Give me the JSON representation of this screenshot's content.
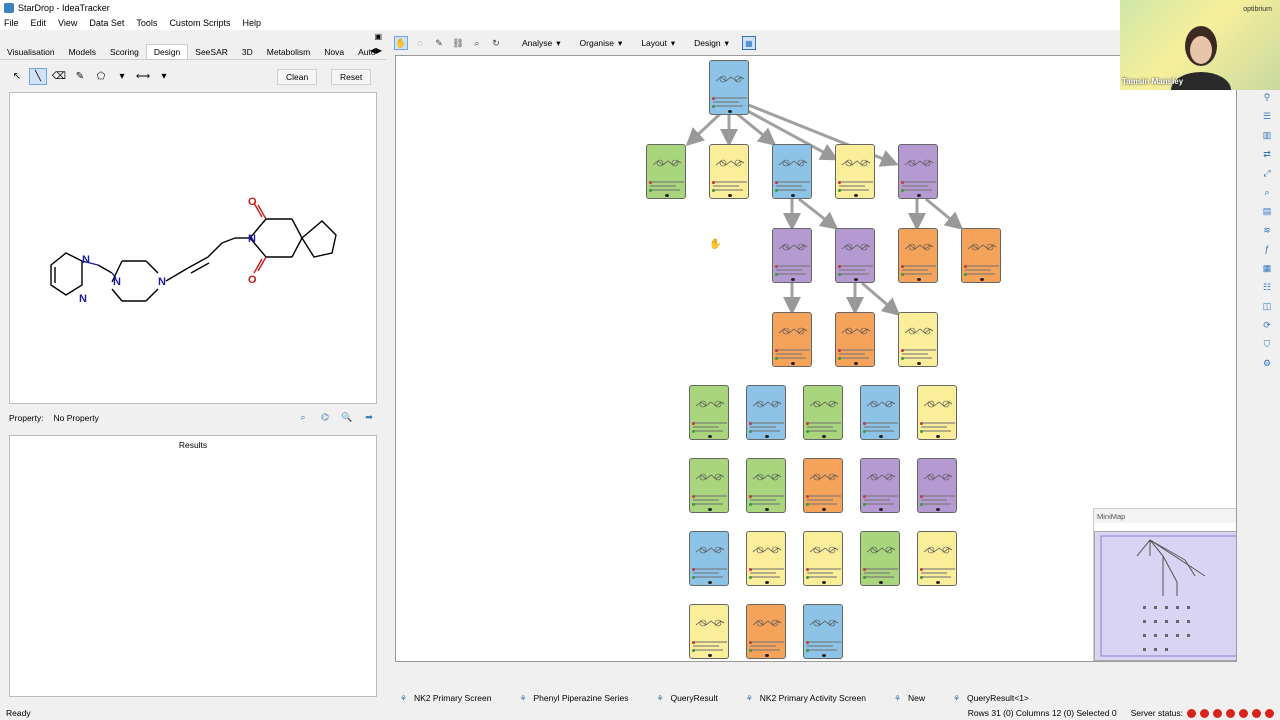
{
  "window": {
    "title": "StarDrop - IdeaTracker"
  },
  "menu": [
    "File",
    "Edit",
    "View",
    "Data Set",
    "Tools",
    "Custom Scripts",
    "Help"
  ],
  "left_tabs": [
    "Visualisation",
    "Models",
    "Scoring",
    "Design",
    "SeeSAR",
    "3D",
    "Metabolism",
    "Nova",
    "Auto"
  ],
  "active_tab": "Design",
  "design": {
    "clean_label": "Clean",
    "reset_label": "Reset"
  },
  "property": {
    "label": "Property:",
    "value": "No Property"
  },
  "results": {
    "header": "Results"
  },
  "molecule": {
    "atoms": [
      "N",
      "N",
      "N",
      "N",
      "N",
      "O",
      "O"
    ]
  },
  "main_toolbar": {
    "menus": [
      "Analyse",
      "Organise",
      "Layout",
      "Design"
    ]
  },
  "minimap": {
    "title": "MiniMap"
  },
  "bottom_tabs": [
    "NK2 Primary Screen",
    "Phenyl Piperazine Series",
    "QueryResult",
    "NK2 Primary Activity Screen",
    "New",
    "QueryResult<1>"
  ],
  "status": {
    "left": "Ready",
    "counts": "Rows 31 (0) Columns 12 (0) Selected 0",
    "server": "Server status:"
  },
  "video": {
    "name": "Tamsin Mansley",
    "logo": "optibrium"
  },
  "colors": {
    "blue": "#8cc3e6",
    "green": "#a9d67c",
    "yellow": "#fbee9b",
    "purple": "#b49ad0",
    "orange": "#f5a35a"
  }
}
